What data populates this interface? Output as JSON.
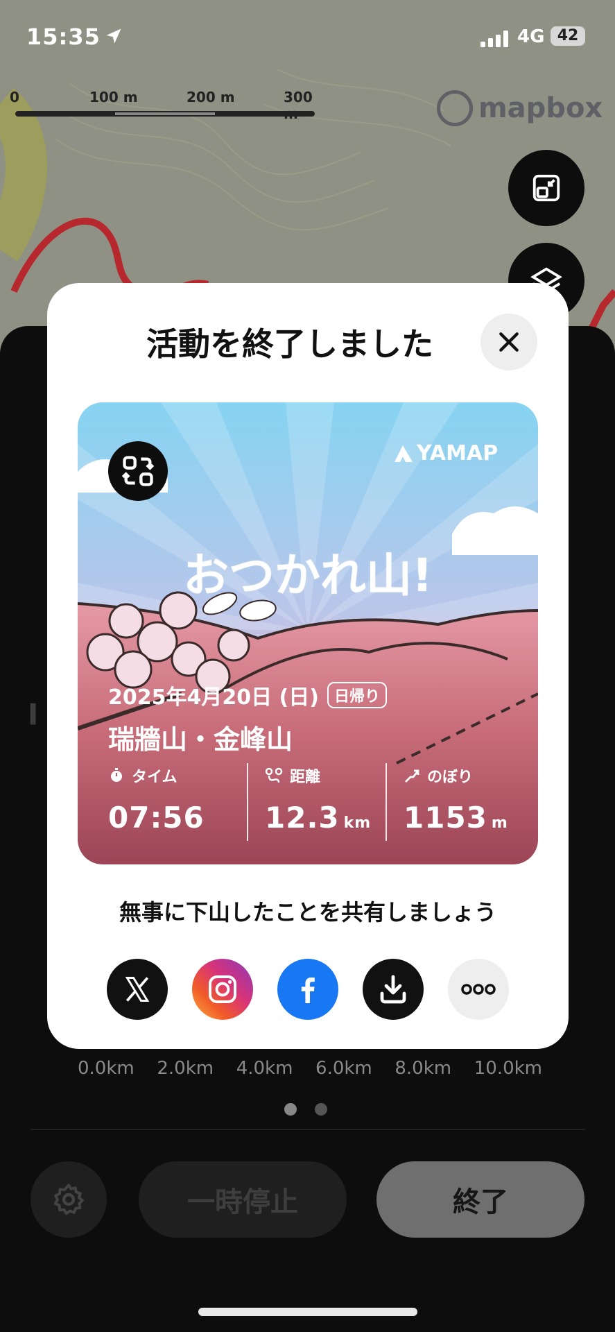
{
  "status_bar": {
    "time": "15:35",
    "network": "4G",
    "battery": "42"
  },
  "map": {
    "scale_labels": [
      "0",
      "100 m",
      "200 m",
      "300 m"
    ],
    "attribution": "mapbox"
  },
  "modal": {
    "title": "活動を終了しました",
    "card": {
      "logo": "YAMAP",
      "headline": "おつかれ山!",
      "date": "2025年4月20日 (日)",
      "trip_badge": "日帰り",
      "mountain": "瑞牆山・金峰山",
      "stats": [
        {
          "label": "タイム",
          "value": "07:56",
          "unit": ""
        },
        {
          "label": "距離",
          "value": "12.3",
          "unit": "km"
        },
        {
          "label": "のぼり",
          "value": "1153",
          "unit": "m"
        }
      ]
    },
    "share_prompt": "無事に下山したことを共有しましょう",
    "share_buttons": [
      "x-icon",
      "instagram-icon",
      "facebook-icon",
      "download-icon",
      "more-icon"
    ]
  },
  "elevation_chart": {
    "x_ticks": [
      "0.0km",
      "2.0km",
      "4.0km",
      "6.0km",
      "8.0km",
      "10.0km"
    ]
  },
  "controls": {
    "pause_label": "一時停止",
    "end_label": "終了"
  },
  "colors": {
    "card_sky": "#8fd3f0",
    "card_pink": "#b45866",
    "instagram": "#d6337a",
    "facebook": "#1877f2"
  }
}
